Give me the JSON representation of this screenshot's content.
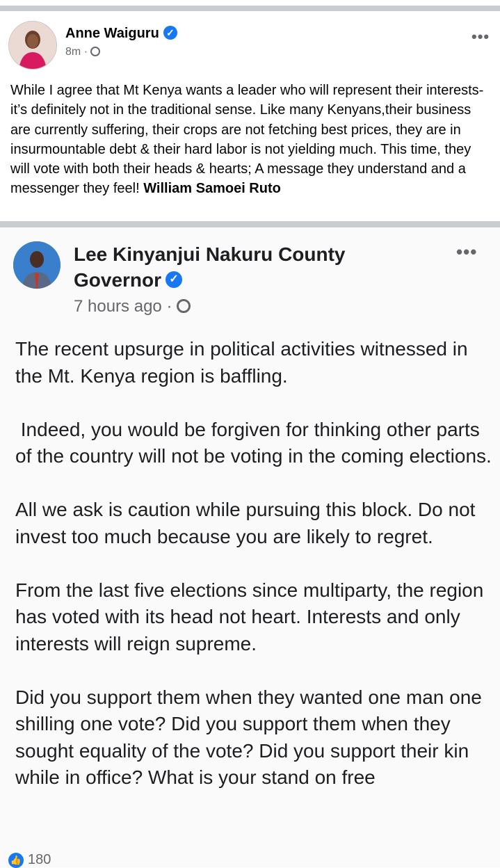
{
  "post1": {
    "author": "Anne Waiguru",
    "verified": true,
    "time": "8m",
    "separator": "·",
    "privacy_icon": "globe-icon",
    "more_icon": "•••",
    "body": "While I agree that Mt Kenya wants a leader who will represent their interests- it’s definitely not in the traditional sense. Like many Kenyans,their business are currently suffering, their crops are not fetching best prices, they are in insurmountable debt & their hard labor is not yielding much. This time, they will vote with both their heads & hearts; A message they understand and a messenger they feel!",
    "mention": "William Samoei Ruto"
  },
  "post2": {
    "author": "Lee Kinyanjui Nakuru County Governor",
    "verified": true,
    "time": "7 hours ago",
    "separator": "·",
    "privacy_icon": "globe-icon",
    "more_icon": "•••",
    "paragraphs": [
      "The recent upsurge in political activities witnessed in the Mt. Kenya region is baffling.",
      " Indeed, you would be forgiven for thinking other parts of the country will not be voting in the coming elections.",
      "All we ask is caution while pursuing this block. Do not invest too much because you are likely to regret.",
      "From the last five elections since multiparty, the region has voted with its head not heart. Interests and only interests will reign supreme.",
      "Did you support them when they wanted one man one shilling one vote? Did you support them when they sought equality of the vote? Did you support their kin while in office? What is your stand on free"
    ]
  },
  "reactions": {
    "icon": "like-icon",
    "count": "180"
  },
  "colors": {
    "facebook_blue": "#1877f2",
    "separator_gray": "#c9ccd1",
    "meta_gray": "#65676b"
  }
}
